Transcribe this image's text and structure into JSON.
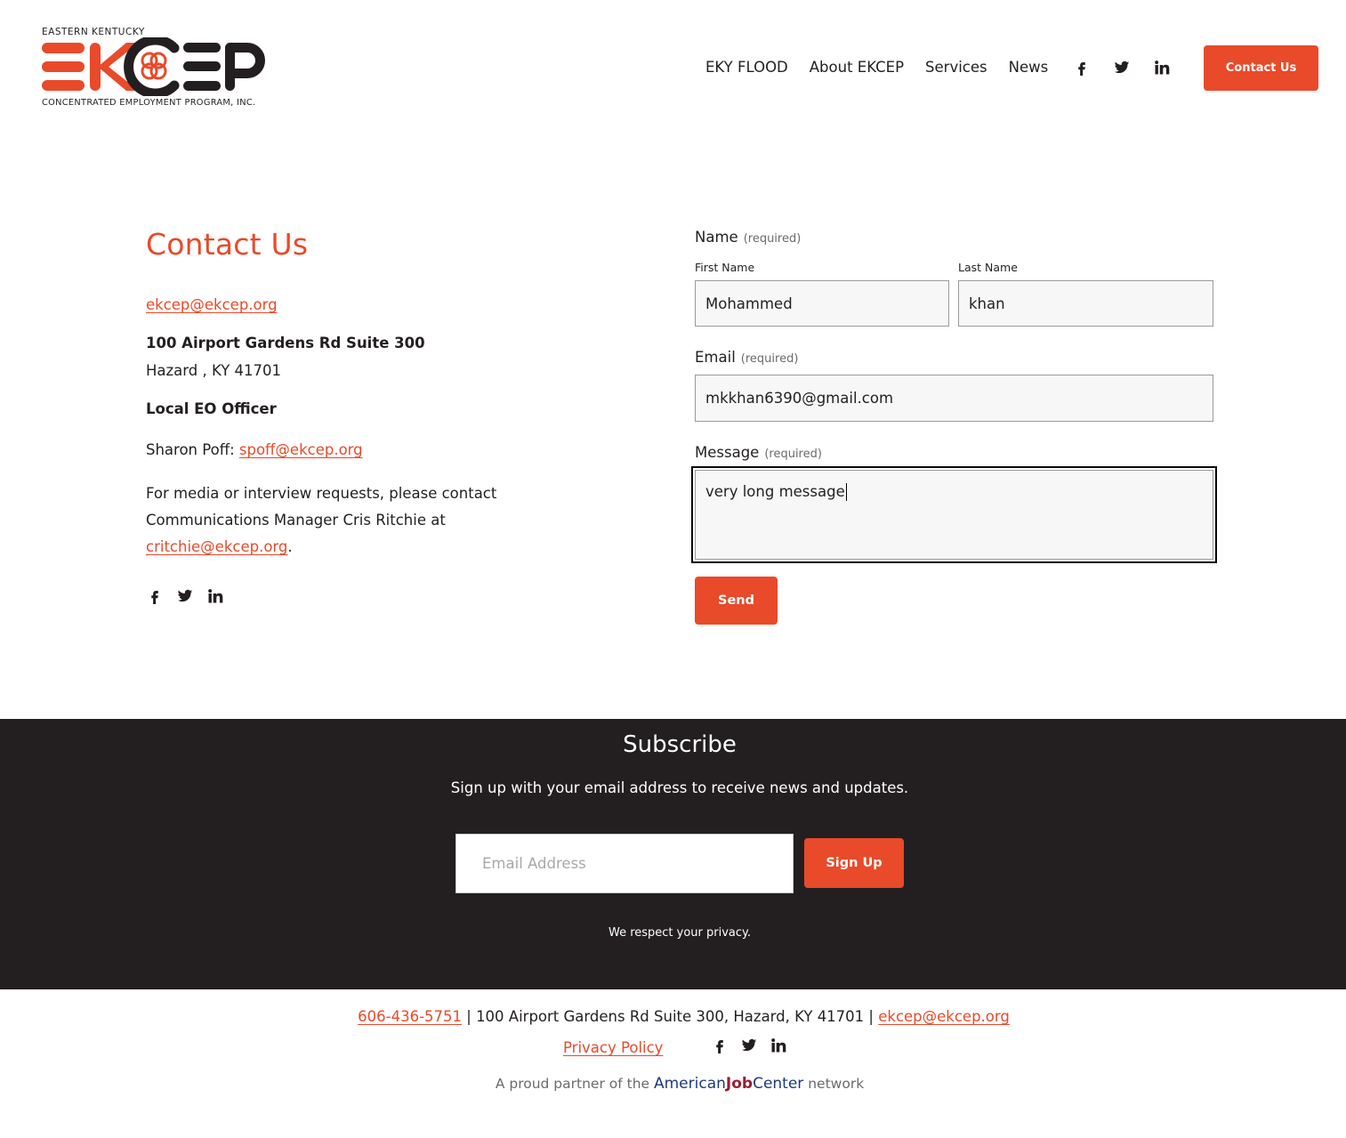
{
  "header": {
    "logo": {
      "top_text": "EASTERN KENTUCKY",
      "main_text": "EKCEP",
      "bottom_text": "CONCENTRATED EMPLOYMENT PROGRAM, INC."
    },
    "nav": [
      "EKY FLOOD",
      "About EKCEP",
      "Services",
      "News"
    ],
    "social_icons": [
      "facebook-icon",
      "twitter-icon",
      "linkedin-icon"
    ],
    "cta_label": "Contact Us"
  },
  "contact": {
    "title": "Contact Us",
    "email": "ekcep@ekcep.org",
    "address_line1": "100 Airport Gardens Rd Suite 300",
    "address_line2": "Hazard , KY 41701",
    "eo_title": "Local EO Officer",
    "eo_name": "Sharon Poff: ",
    "eo_email": "spoff@ekcep.org",
    "media_text": "For media or interview requests, please contact Communications Manager Cris Ritchie at ",
    "media_email": "critchie@ekcep.org",
    "media_suffix": "."
  },
  "form": {
    "name_label": "Name",
    "required_text": "(required)",
    "first_name_label": "First Name",
    "last_name_label": "Last Name",
    "first_name_value": "Mohammed",
    "last_name_value": "khan",
    "email_label": "Email",
    "email_value": "mkkhan6390@gmail.com",
    "message_label": "Message",
    "message_value": "very long message",
    "send_label": "Send"
  },
  "subscribe": {
    "title": "Subscribe",
    "text": "Sign up with your email address to receive news and updates.",
    "email_placeholder": "Email Address",
    "signup_label": "Sign Up",
    "privacy_note": "We respect your privacy."
  },
  "footer": {
    "phone": "606-436-5751",
    "address_mid": " | 100 Airport Gardens Rd Suite 300, Hazard, KY 41701 | ",
    "email": "ekcep@ekcep.org",
    "privacy_policy": "Privacy Policy",
    "partner_prefix": "A proud partner of the ",
    "partner_american": "American",
    "partner_job": "Job",
    "partner_center": "Center",
    "partner_suffix": " network"
  },
  "colors": {
    "accent": "#e84a2a",
    "dark": "#231f20",
    "input_bg": "#f7f7f7"
  }
}
